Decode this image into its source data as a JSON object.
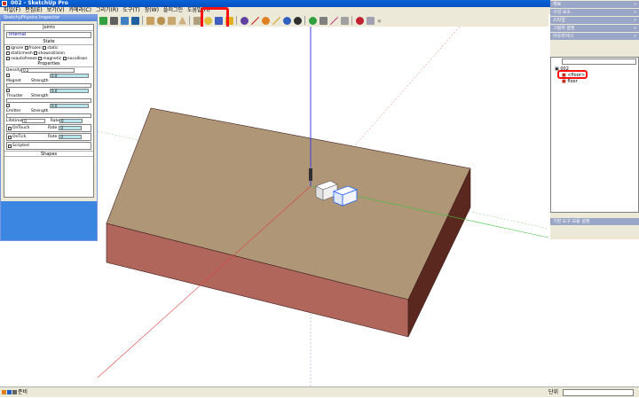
{
  "window": {
    "title": "002 - SketchUp Pro"
  },
  "menu": [
    "파일(F)",
    "편집(E)",
    "보기(V)",
    "카메라(C)",
    "그리기(R)",
    "도구(T)",
    "창(W)",
    "플러그인",
    "도움말(H)"
  ],
  "toolbar": {
    "icons": [
      "play-icon",
      "pause-icon",
      "sketchyphysics-icon",
      "ui-icon",
      "sep",
      "box-icon",
      "cylinder-icon",
      "cylinder-alt-icon",
      "cone-icon",
      "sep",
      "floor-wedge-icon",
      "sphere-icon",
      "wedge-icon",
      "chain-icon",
      "sep",
      "hinge-icon",
      "slider-icon",
      "spring-icon",
      "piston-icon",
      "servo-icon",
      "ball-joint-icon",
      "sep",
      "gear-icon",
      "magnet-icon",
      "thruster-icon",
      "emitter-icon",
      "sep",
      "record-icon",
      "ruler-icon",
      "collapse-icon"
    ]
  },
  "dialog": {
    "title": "SketchyPhysics Inspector",
    "joints_header": "Joints",
    "joints_value": "internal",
    "state_header": "State",
    "state_checks": [
      [
        "ignore",
        "frozen",
        "static"
      ],
      [
        "staticmesh",
        "showcollision"
      ],
      [
        "noautofreeze",
        "magnetic",
        "nocollison"
      ]
    ],
    "properties_header": "Properties",
    "density_label": "Density",
    "density_value": "0.2",
    "magnet_label": "Magnet",
    "magnet_strength_label": "Strength",
    "magnet_strength_value": "0.0",
    "thruster_label": "Thruster",
    "thruster_strength_label": "Strength",
    "thruster_strength_value": "0.0",
    "emitter_label": "Emitter",
    "emitter_strength_label": "Strength",
    "emitter_strength_value": "0.0",
    "lifetime_label": "Lifetime",
    "lifetime_value": "0",
    "rate_label": "Rate",
    "rate_value": "0",
    "ontouch_label": "OnTouch",
    "ontouch_rate_label": "Rate",
    "ontouch_rate_value": "0",
    "ontick_label": "OnTick",
    "ontick_rate_label": "Rate",
    "ontick_rate_value": "0",
    "scripted_label": "Scripted",
    "shapes_header": "Shapes"
  },
  "right_panel": {
    "trays": [
      "재료",
      "구성 요소",
      "스타일",
      "그림자 설정",
      "아웃라이너"
    ],
    "outliner_root": "002",
    "outliner_items": [
      "<floor>",
      "floor"
    ],
    "bottom_tray": "기본 도구 모음 설정"
  },
  "status": {
    "text": "준비",
    "measurement_label": "단위"
  },
  "colors": {
    "floor_top": "#ae9676",
    "floor_side": "#b0665a",
    "floor_dark_side": "#5a281e",
    "box_top": "#ffffff",
    "selection_blue": "#2060ff",
    "axis_red": "#e04040",
    "axis_green": "#40c040",
    "axis_blue": "#4040e0",
    "highlight_red": "#ff1010"
  }
}
